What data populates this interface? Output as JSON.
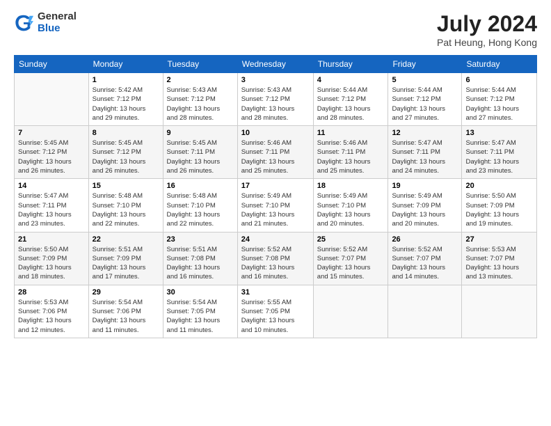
{
  "header": {
    "logo_general": "General",
    "logo_blue": "Blue",
    "month_title": "July 2024",
    "location": "Pat Heung, Hong Kong"
  },
  "weekdays": [
    "Sunday",
    "Monday",
    "Tuesday",
    "Wednesday",
    "Thursday",
    "Friday",
    "Saturday"
  ],
  "weeks": [
    [
      {
        "day": "",
        "info": ""
      },
      {
        "day": "1",
        "info": "Sunrise: 5:42 AM\nSunset: 7:12 PM\nDaylight: 13 hours\nand 29 minutes."
      },
      {
        "day": "2",
        "info": "Sunrise: 5:43 AM\nSunset: 7:12 PM\nDaylight: 13 hours\nand 28 minutes."
      },
      {
        "day": "3",
        "info": "Sunrise: 5:43 AM\nSunset: 7:12 PM\nDaylight: 13 hours\nand 28 minutes."
      },
      {
        "day": "4",
        "info": "Sunrise: 5:44 AM\nSunset: 7:12 PM\nDaylight: 13 hours\nand 28 minutes."
      },
      {
        "day": "5",
        "info": "Sunrise: 5:44 AM\nSunset: 7:12 PM\nDaylight: 13 hours\nand 27 minutes."
      },
      {
        "day": "6",
        "info": "Sunrise: 5:44 AM\nSunset: 7:12 PM\nDaylight: 13 hours\nand 27 minutes."
      }
    ],
    [
      {
        "day": "7",
        "info": "Sunrise: 5:45 AM\nSunset: 7:12 PM\nDaylight: 13 hours\nand 26 minutes."
      },
      {
        "day": "8",
        "info": "Sunrise: 5:45 AM\nSunset: 7:12 PM\nDaylight: 13 hours\nand 26 minutes."
      },
      {
        "day": "9",
        "info": "Sunrise: 5:45 AM\nSunset: 7:11 PM\nDaylight: 13 hours\nand 26 minutes."
      },
      {
        "day": "10",
        "info": "Sunrise: 5:46 AM\nSunset: 7:11 PM\nDaylight: 13 hours\nand 25 minutes."
      },
      {
        "day": "11",
        "info": "Sunrise: 5:46 AM\nSunset: 7:11 PM\nDaylight: 13 hours\nand 25 minutes."
      },
      {
        "day": "12",
        "info": "Sunrise: 5:47 AM\nSunset: 7:11 PM\nDaylight: 13 hours\nand 24 minutes."
      },
      {
        "day": "13",
        "info": "Sunrise: 5:47 AM\nSunset: 7:11 PM\nDaylight: 13 hours\nand 23 minutes."
      }
    ],
    [
      {
        "day": "14",
        "info": "Sunrise: 5:47 AM\nSunset: 7:11 PM\nDaylight: 13 hours\nand 23 minutes."
      },
      {
        "day": "15",
        "info": "Sunrise: 5:48 AM\nSunset: 7:10 PM\nDaylight: 13 hours\nand 22 minutes."
      },
      {
        "day": "16",
        "info": "Sunrise: 5:48 AM\nSunset: 7:10 PM\nDaylight: 13 hours\nand 22 minutes."
      },
      {
        "day": "17",
        "info": "Sunrise: 5:49 AM\nSunset: 7:10 PM\nDaylight: 13 hours\nand 21 minutes."
      },
      {
        "day": "18",
        "info": "Sunrise: 5:49 AM\nSunset: 7:10 PM\nDaylight: 13 hours\nand 20 minutes."
      },
      {
        "day": "19",
        "info": "Sunrise: 5:49 AM\nSunset: 7:09 PM\nDaylight: 13 hours\nand 20 minutes."
      },
      {
        "day": "20",
        "info": "Sunrise: 5:50 AM\nSunset: 7:09 PM\nDaylight: 13 hours\nand 19 minutes."
      }
    ],
    [
      {
        "day": "21",
        "info": "Sunrise: 5:50 AM\nSunset: 7:09 PM\nDaylight: 13 hours\nand 18 minutes."
      },
      {
        "day": "22",
        "info": "Sunrise: 5:51 AM\nSunset: 7:09 PM\nDaylight: 13 hours\nand 17 minutes."
      },
      {
        "day": "23",
        "info": "Sunrise: 5:51 AM\nSunset: 7:08 PM\nDaylight: 13 hours\nand 16 minutes."
      },
      {
        "day": "24",
        "info": "Sunrise: 5:52 AM\nSunset: 7:08 PM\nDaylight: 13 hours\nand 16 minutes."
      },
      {
        "day": "25",
        "info": "Sunrise: 5:52 AM\nSunset: 7:07 PM\nDaylight: 13 hours\nand 15 minutes."
      },
      {
        "day": "26",
        "info": "Sunrise: 5:52 AM\nSunset: 7:07 PM\nDaylight: 13 hours\nand 14 minutes."
      },
      {
        "day": "27",
        "info": "Sunrise: 5:53 AM\nSunset: 7:07 PM\nDaylight: 13 hours\nand 13 minutes."
      }
    ],
    [
      {
        "day": "28",
        "info": "Sunrise: 5:53 AM\nSunset: 7:06 PM\nDaylight: 13 hours\nand 12 minutes."
      },
      {
        "day": "29",
        "info": "Sunrise: 5:54 AM\nSunset: 7:06 PM\nDaylight: 13 hours\nand 11 minutes."
      },
      {
        "day": "30",
        "info": "Sunrise: 5:54 AM\nSunset: 7:05 PM\nDaylight: 13 hours\nand 11 minutes."
      },
      {
        "day": "31",
        "info": "Sunrise: 5:55 AM\nSunset: 7:05 PM\nDaylight: 13 hours\nand 10 minutes."
      },
      {
        "day": "",
        "info": ""
      },
      {
        "day": "",
        "info": ""
      },
      {
        "day": "",
        "info": ""
      }
    ]
  ]
}
